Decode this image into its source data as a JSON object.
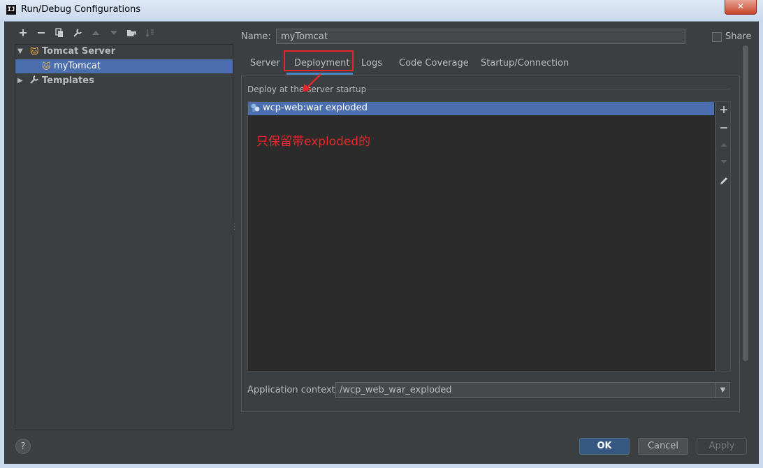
{
  "window": {
    "title": "Run/Debug Configurations",
    "close_glyph": "✕",
    "app_icon_text": "IJ"
  },
  "toolbar": {
    "icons": [
      "add-icon",
      "remove-icon",
      "copy-icon",
      "wrench-icon",
      "move-up-icon",
      "move-down-icon",
      "folder-icon",
      "sort-icon"
    ]
  },
  "tree": {
    "items": [
      {
        "label": "Tomcat Server",
        "expanded": true,
        "selected": false,
        "bold": true
      },
      {
        "label": "myTomcat",
        "selected": true,
        "bold": false
      },
      {
        "label": "Templates",
        "expanded": false,
        "selected": false,
        "bold": true
      }
    ]
  },
  "name": {
    "label": "Name:",
    "value": "myTomcat"
  },
  "share": {
    "label": "Share",
    "checked": false
  },
  "tabs": [
    {
      "label": "Server",
      "active": false
    },
    {
      "label": "Deployment",
      "active": true
    },
    {
      "label": "Logs",
      "active": false
    },
    {
      "label": "Code Coverage",
      "active": false
    },
    {
      "label": "Startup/Connection",
      "active": false
    }
  ],
  "deployment": {
    "caption": "Deploy at the server startup",
    "items": [
      "wcp-web:war exploded"
    ],
    "annotation": "只保留带exploded的"
  },
  "context": {
    "label": "Application context:",
    "value": "/wcp_web_war_exploded"
  },
  "buttons": {
    "help": "?",
    "ok": "OK",
    "cancel": "Cancel",
    "apply": "Apply"
  },
  "colors": {
    "background": "#3c3f41",
    "selection": "#4b6eaf",
    "annotation": "#e5272b",
    "ok_button": "#365880"
  }
}
